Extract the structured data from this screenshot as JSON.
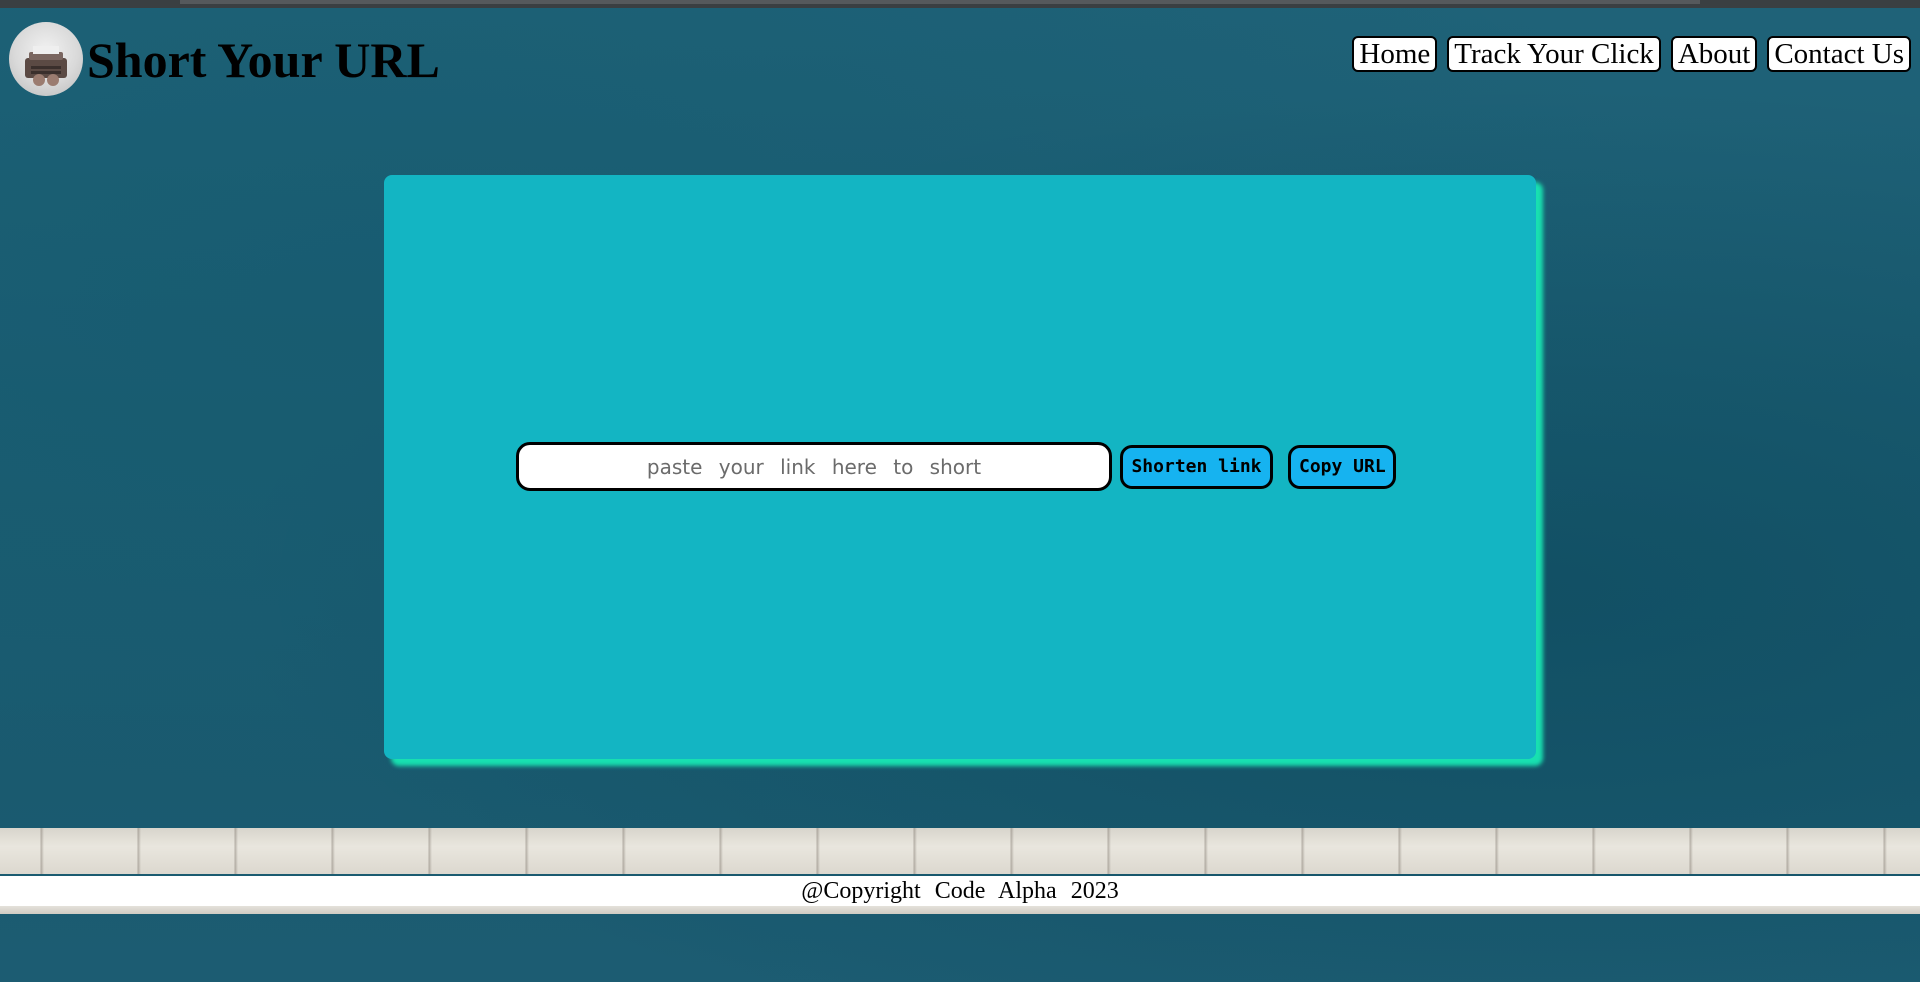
{
  "header": {
    "title": "Short Your URL",
    "logo_icon": "typewriter-icon"
  },
  "nav": {
    "items": [
      {
        "label": "Home"
      },
      {
        "label": "Track Your Click"
      },
      {
        "label": "About"
      },
      {
        "label": "Contact Us"
      }
    ]
  },
  "shortener": {
    "input_placeholder": "paste your link here to short",
    "input_value": "",
    "shorten_label": "Shorten link",
    "copy_label": "Copy URL"
  },
  "footer": {
    "text": "@Copyright Code Alpha 2023"
  },
  "colors": {
    "background": "#1c5d72",
    "card": "#13b5c3",
    "card_shadow": "#18e0b0",
    "button": "#16b3f0"
  }
}
